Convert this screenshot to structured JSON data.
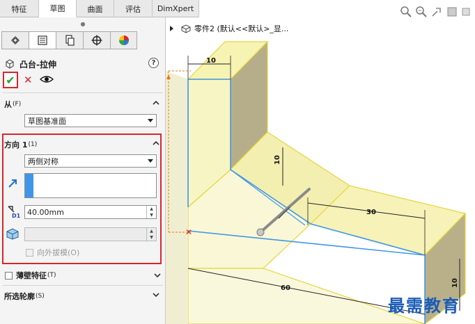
{
  "command_tabs": [
    "特征",
    "草图",
    "曲面",
    "评估",
    "DimXpert"
  ],
  "active_tab": "草图",
  "feature": {
    "title": "凸台-拉伸",
    "help": "?"
  },
  "from_section": {
    "label": "从",
    "hotkey": "(F)",
    "value": "草图基准面"
  },
  "direction_section": {
    "label": "方向 1",
    "hotkey": "(1)",
    "end_condition": "两侧对称",
    "depth_value": "40.00mm",
    "draft_outward_label": "向外拔模(O)"
  },
  "thin_feature": {
    "label": "薄壁特征",
    "hotkey": "(T)"
  },
  "selected_contours": {
    "label": "所选轮廓",
    "hotkey": "(S)"
  },
  "tree": {
    "part_label": "零件2 (默认<<默认>_显..."
  },
  "dimensions": {
    "top_width": "10",
    "vertical_step": "10",
    "mid_width": "30",
    "bottom_length": "60",
    "right_height": "10"
  },
  "watermark": "最需教育",
  "colors": {
    "accent_red": "#d9252b",
    "ok_green": "#23a127",
    "model_face": "#f5f3b4",
    "model_edge": "#e8d83a",
    "sketch_blue": "#3f96e8"
  }
}
